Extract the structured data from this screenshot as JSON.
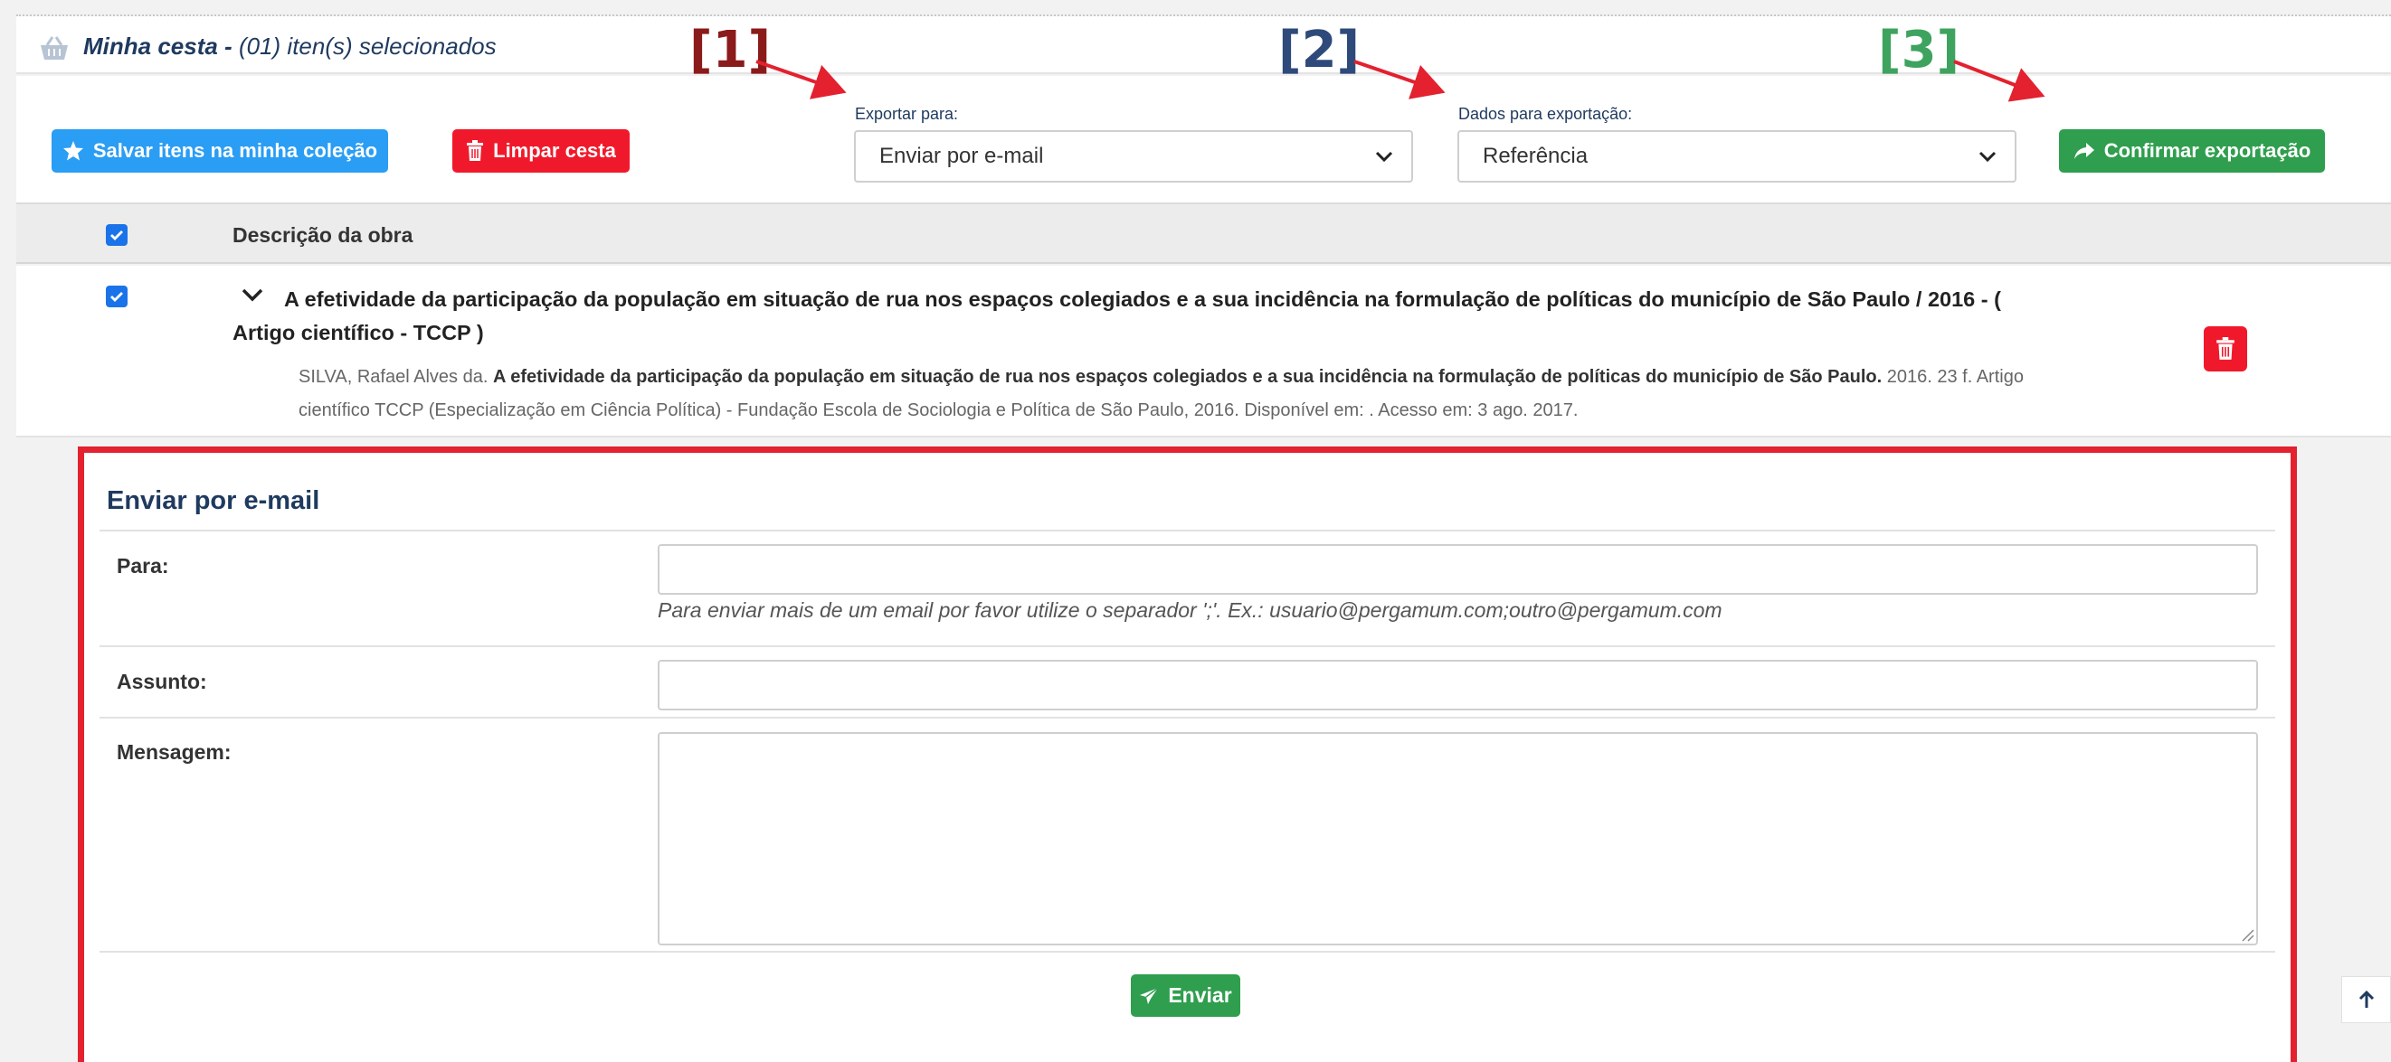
{
  "cart": {
    "title_main": "Minha cesta - ",
    "count": "(01)",
    "title_rest": " iten(s) selecionados"
  },
  "toolbar": {
    "save_label": "Salvar itens na minha coleção",
    "clear_label": "Limpar cesta",
    "confirm_label": "Confirmar exportação"
  },
  "export": {
    "label": "Exportar para:",
    "selected": "Enviar por e-mail"
  },
  "data_export": {
    "label": "Dados para exportação:",
    "selected": "Referência"
  },
  "annotations": [
    "[1]",
    "[2]",
    "[3]"
  ],
  "table": {
    "header_desc": "Descrição da obra"
  },
  "item": {
    "title": "A efetividade da participação da população em situação de rua nos espaços colegiados e a sua incidência na formulação de políticas do município de São Paulo / 2016 - ( Artigo científico - TCCP )",
    "ref_author": "SILVA, Rafael Alves da. ",
    "ref_title": "A efetividade da participação da população em situação de rua nos espaços colegiados e a sua incidência na formulação de políticas do município de São Paulo.",
    "ref_rest": " 2016. 23 f. Artigo científico TCCP (Especialização em Ciência Política) - Fundação Escola de Sociologia e Política de São Paulo, 2016. Disponível em: . Acesso em: 3 ago. 2017."
  },
  "email": {
    "title": "Enviar por e-mail",
    "to_label": "Para:",
    "to_hint": "Para enviar mais de um email por favor utilize o separador ';'. Ex.: usuario@pergamum.com;outro@pergamum.com",
    "subject_label": "Assunto:",
    "message_label": "Mensagem:",
    "send_label": "Enviar"
  },
  "colors": {
    "blue": "#2a9df4",
    "red": "#f0192b",
    "green": "#2f9e4e",
    "highlight_border": "#e3212f"
  }
}
